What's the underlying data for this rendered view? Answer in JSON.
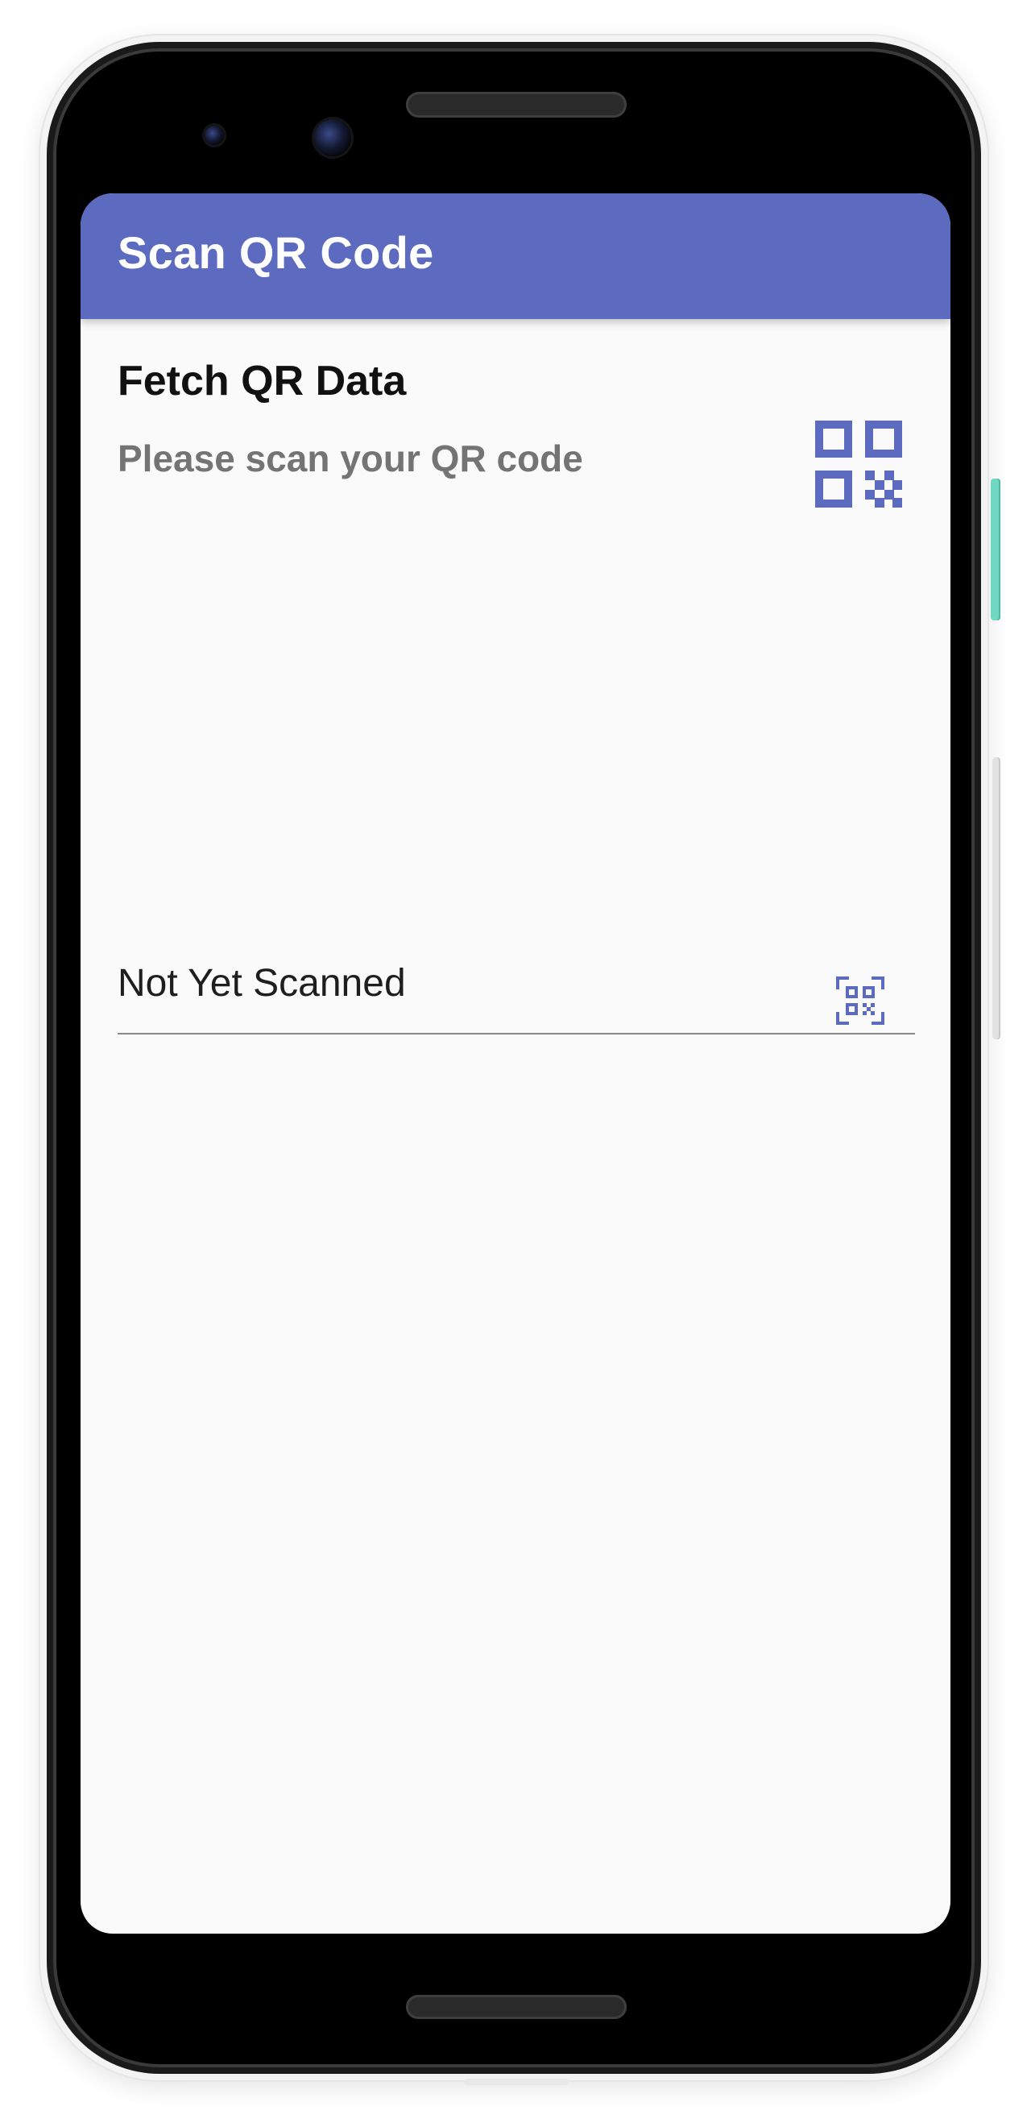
{
  "app_bar": {
    "title": "Scan QR Code",
    "color": "#5c6bc0"
  },
  "section": {
    "title": "Fetch QR Data",
    "subtitle": "Please scan your QR code",
    "qr_icon": "qr-code-icon"
  },
  "scan_field": {
    "value": "Not Yet Scanned",
    "scan_icon": "qr-code-scanner-icon"
  },
  "colors": {
    "accent": "#5c6bc0",
    "screen_background": "#fafafa",
    "subtitle_text": "#747474",
    "side_button": "#6fd8c2"
  }
}
